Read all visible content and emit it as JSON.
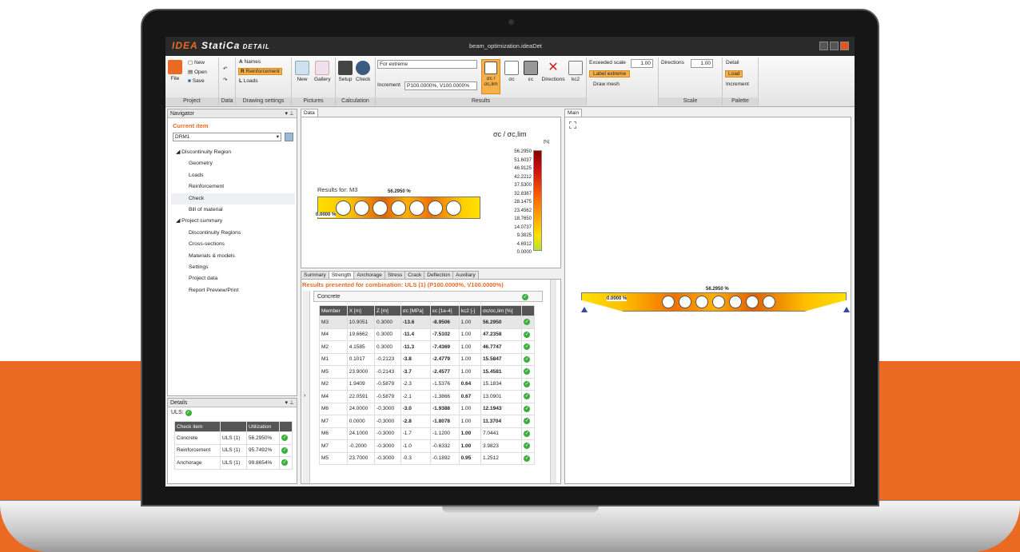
{
  "window": {
    "title": "beam_optimization.ideaDet",
    "brand": "StatiCa",
    "brand_prefix": "IDEA",
    "brand_suffix": "DETAIL"
  },
  "ribbon": {
    "file_label": "File",
    "new_label": "New",
    "open_label": "Open",
    "save_label": "Save",
    "project_group": "Project",
    "data_group": "Data",
    "names_label": "Names",
    "reinforcement_label": "Reinforcement",
    "loads_label": "Loads",
    "drawing_settings_group": "Drawing settings",
    "new_picture_label": "New",
    "gallery_label": "Gallery",
    "pictures_group": "Pictures",
    "setup_label": "Setup",
    "check_label": "Check",
    "calculation_group": "Calculation",
    "extreme_select": "For extreme",
    "increment_label": "Increment",
    "increment_select": "P100.0000%, V100.0000%",
    "sigma_lim_label": "σc / σc,lim",
    "sigma_c_label": "σc",
    "eps_c_label": "εc",
    "directions_label": "Directions",
    "kc2_label": "kc2",
    "results_group": "Results",
    "exceeded_scale_label": "Exceeded scale",
    "exceeded_scale_value": "1.00",
    "label_extreme": "Label extreme",
    "draw_mesh": "Draw mesh",
    "directions_scale_label": "Directions",
    "directions_scale_value": "1.00",
    "scale_group": "Scale",
    "detail_label": "Detail",
    "load_label": "Load",
    "increment_palette_label": "Increment",
    "palette_group": "Palette"
  },
  "navigator": {
    "title": "Navigator",
    "current_item": "Current item",
    "selected": "DRM1",
    "items": [
      {
        "label": "Discontinuity Region",
        "level": 0
      },
      {
        "label": "Geometry",
        "level": 1
      },
      {
        "label": "Loads",
        "level": 1
      },
      {
        "label": "Reinforcement",
        "level": 1
      },
      {
        "label": "Check",
        "level": 1
      },
      {
        "label": "Bill of material",
        "level": 1
      },
      {
        "label": "Project summary",
        "level": 0
      },
      {
        "label": "Discontinuity Regions",
        "level": 1
      },
      {
        "label": "Cross-sections",
        "level": 1
      },
      {
        "label": "Materials & models",
        "level": 1
      },
      {
        "label": "Settings",
        "level": 1
      },
      {
        "label": "Project data",
        "level": 1
      },
      {
        "label": "Report Preview/Print",
        "level": 1
      }
    ]
  },
  "details": {
    "title": "Details",
    "uls_label": "ULS:",
    "col_item": "Check item",
    "col_util": "Utilization",
    "rows": [
      {
        "item": "Concrete",
        "combo": "ULS (1)",
        "util": "56.2950%"
      },
      {
        "item": "Reinforcement",
        "combo": "ULS (1)",
        "util": "95.7492%"
      },
      {
        "item": "Anchorage",
        "combo": "ULS (1)",
        "util": "99.8654%"
      }
    ]
  },
  "data_panel": {
    "tab": "Data",
    "results_for": "Results for: M3",
    "peak_label": "56.2950 %",
    "zero_label": "0.0000 %",
    "legend_title": "σc / σc,lim",
    "legend_unit": "[%]",
    "legend_values": [
      "56.2950",
      "51.6037",
      "46.9125",
      "42.2212",
      "37.5300",
      "32.8387",
      "28.1475",
      "23.4562",
      "18.7650",
      "14.0737",
      "9.3825",
      "4.6912",
      "0.0000"
    ]
  },
  "results": {
    "tabs": [
      "Summary",
      "Strength",
      "Anchorage",
      "Stress",
      "Crack",
      "Deflection",
      "Auxiliary"
    ],
    "active_tab": "Strength",
    "combination_text": "Results presented for combination: ULS (1) (P100.0000%, V100.0000%)",
    "section_label": "Concrete",
    "columns": [
      "Member",
      "X [m]",
      "Z [m]",
      "σc [MPa]",
      "εc [1e-4]",
      "kc2 [-]",
      "σc/σc,lim [%]"
    ],
    "rows": [
      [
        "M3",
        "10.9051",
        "0.3000",
        "-13.6",
        "-8.9506",
        "1.00",
        "56.2950"
      ],
      [
        "M4",
        "19.6662",
        "0.3000",
        "-11.4",
        "-7.5102",
        "1.00",
        "47.2358"
      ],
      [
        "M2",
        "4.1585",
        "0.3000",
        "-11.3",
        "-7.4369",
        "1.00",
        "46.7747"
      ],
      [
        "M1",
        "0.1017",
        "-0.2123",
        "-3.8",
        "-2.4779",
        "1.00",
        "15.5847"
      ],
      [
        "M5",
        "23.9000",
        "-0.2143",
        "-3.7",
        "-2.4577",
        "1.00",
        "15.4581"
      ],
      [
        "M2",
        "1.9409",
        "-0.5879",
        "-2.3",
        "-1.5376",
        "0.64",
        "15.1834"
      ],
      [
        "M4",
        "22.0591",
        "-0.5879",
        "-2.1",
        "-1.3866",
        "0.67",
        "13.0901"
      ],
      [
        "M6",
        "24.0000",
        "-0.3000",
        "-3.0",
        "-1.9388",
        "1.00",
        "12.1943"
      ],
      [
        "M7",
        "0.0000",
        "-0.3000",
        "-2.8",
        "-1.8078",
        "1.00",
        "11.3704"
      ],
      [
        "M6",
        "24.1000",
        "-0.3000",
        "-1.7",
        "-1.1200",
        "1.00",
        "7.0441"
      ],
      [
        "M7",
        "-0.2000",
        "-0.3000",
        "-1.0",
        "-0.6332",
        "1.00",
        "3.9823"
      ],
      [
        "M5",
        "23.7000",
        "-0.3000",
        "-0.3",
        "-0.1892",
        "0.95",
        "1.2512"
      ]
    ]
  },
  "main_panel": {
    "tab": "Main",
    "peak_label": "56.2950 %",
    "zero_label": "0.0000 %"
  },
  "colors": {
    "accent": "#ea6a23",
    "ok": "#3cae3c"
  }
}
